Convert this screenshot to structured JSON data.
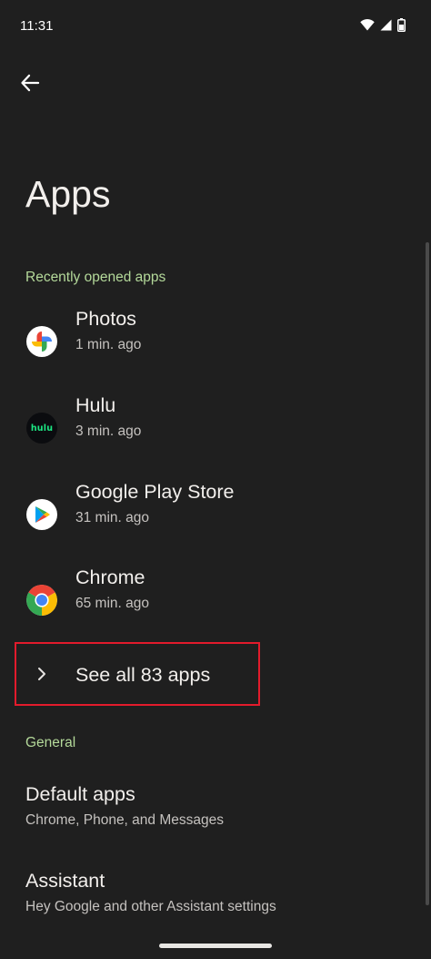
{
  "status_bar": {
    "time": "11:31",
    "icons": [
      "wifi-icon",
      "signal-icon",
      "battery-icon"
    ]
  },
  "header": {
    "back_icon": "arrow-left-icon",
    "title": "Apps"
  },
  "recent_apps": {
    "header": "Recently opened apps",
    "items": [
      {
        "name": "Photos",
        "time": "1 min. ago",
        "icon": "photos-icon"
      },
      {
        "name": "Hulu",
        "time": "3 min. ago",
        "icon": "hulu-icon",
        "icon_text": "hulu"
      },
      {
        "name": "Google Play Store",
        "time": "31 min. ago",
        "icon": "play-store-icon"
      },
      {
        "name": "Chrome",
        "time": "65 min. ago",
        "icon": "chrome-icon"
      }
    ],
    "see_all_label": "See all 83 apps"
  },
  "general": {
    "header": "General",
    "items": [
      {
        "title": "Default apps",
        "summary": "Chrome, Phone, and Messages"
      },
      {
        "title": "Assistant",
        "summary": "Hey Google and other Assistant settings"
      }
    ]
  },
  "colors": {
    "background": "#1f1f1f",
    "accent_header": "#b4d99a",
    "highlight_border": "#e21b2c",
    "hulu_green": "#1ce783"
  }
}
